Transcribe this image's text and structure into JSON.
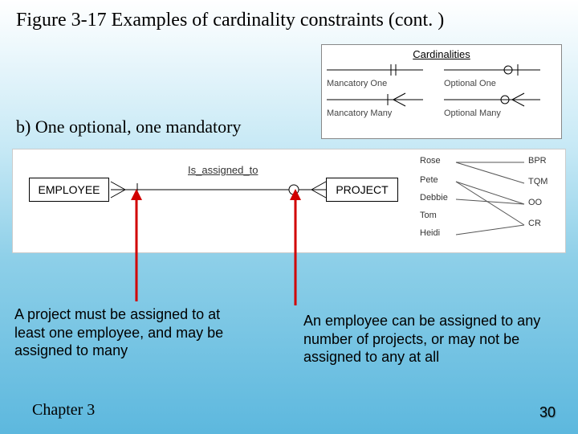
{
  "title": "Figure 3-17 Examples of cardinality constraints (cont. )",
  "subtitle": "b) One optional, one mandatory",
  "legend": {
    "heading": "Cardinalities",
    "items": [
      {
        "label": "Mancatory One"
      },
      {
        "label": "Optional One"
      },
      {
        "label": "Mancatory Many"
      },
      {
        "label": "Optional Many"
      }
    ]
  },
  "erd": {
    "left_entity": "EMPLOYEE",
    "relationship": "Is_assigned_to",
    "right_entity": "PROJECT"
  },
  "mapping": {
    "left": [
      "Rose",
      "Pete",
      "Debbie",
      "Tom",
      "Heidi"
    ],
    "right": [
      "BPR",
      "TQM",
      "OO",
      "CR"
    ]
  },
  "notes": {
    "left": "A project must be assigned to at least one employee, and may be assigned to many",
    "right": "An employee can be assigned to any number of projects, or may not be assigned to any at all"
  },
  "footer": {
    "chapter": "Chapter 3",
    "page": "30"
  },
  "chart_data": {
    "type": "table",
    "title": "ER cardinality example: Employee Is_assigned_to Project",
    "entities": [
      "EMPLOYEE",
      "PROJECT"
    ],
    "relationship": "Is_assigned_to",
    "employee_side_cardinality": "mandatory many (a project must have ≥1 employee)",
    "project_side_cardinality": "optional many (an employee may have 0..n projects)",
    "sample_mapping": [
      {
        "employee": "Rose",
        "projects": [
          "BPR",
          "TQM"
        ]
      },
      {
        "employee": "Pete",
        "projects": [
          "OO",
          "CR"
        ]
      },
      {
        "employee": "Debbie",
        "projects": [
          "OO"
        ]
      },
      {
        "employee": "Tom",
        "projects": []
      },
      {
        "employee": "Heidi",
        "projects": [
          "CR"
        ]
      }
    ],
    "legend": [
      "Mandatory One",
      "Optional One",
      "Mandatory Many",
      "Optional Many"
    ]
  }
}
